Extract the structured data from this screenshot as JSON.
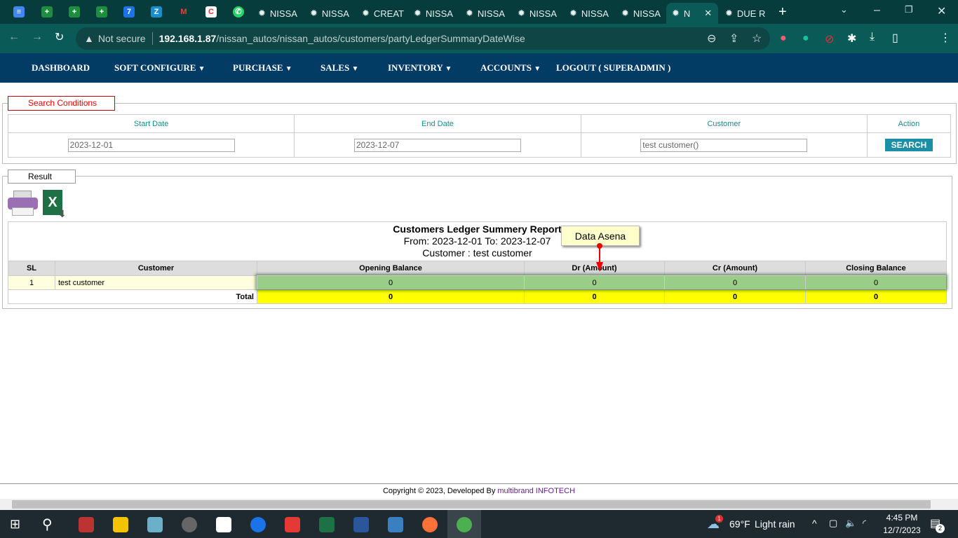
{
  "browser": {
    "tabs": [
      "NISSA",
      "NISSA",
      "CREAT",
      "NISSA",
      "NISSA",
      "NISSA",
      "NISSA",
      "NISSA",
      "N",
      "DUE R"
    ],
    "not_secure": "Not secure",
    "url_host": "192.168.1.87",
    "url_path": "/nissan_autos/nissan_autos/customers/partyLedgerSummaryDateWise"
  },
  "nav": {
    "items": [
      "DASHBOARD",
      "SOFT CONFIGURE",
      "PURCHASE",
      "SALES",
      "INVENTORY",
      "ACCOUNTS",
      "LOGOUT ( SUPERADMIN )"
    ]
  },
  "search": {
    "legend": "Search Conditions",
    "headers": [
      "Start Date",
      "End Date",
      "Customer",
      "Action"
    ],
    "start_date": "2023-12-01",
    "end_date": "2023-12-07",
    "customer": "test customer()",
    "button": "SEARCH"
  },
  "result": {
    "legend": "Result",
    "title": "Customers Ledger Summery Report",
    "range": "From: 2023-12-01 To: 2023-12-07",
    "customer_line": "Customer : test customer",
    "columns": [
      "SL",
      "Customer",
      "Opening Balance",
      "Dr (Amount)",
      "Cr (Amount)",
      "Closing Balance"
    ],
    "rows": [
      {
        "sl": "1",
        "customer": "test customer",
        "opening": "0",
        "dr": "0",
        "cr": "0",
        "closing": "0"
      }
    ],
    "total": {
      "label": "Total",
      "opening": "0",
      "dr": "0",
      "cr": "0",
      "closing": "0"
    }
  },
  "tooltip": "Data Asena",
  "footer": {
    "text": "Copyright © 2023, Developed By ",
    "brand": "multibrand INFOTECH"
  },
  "taskbar": {
    "weather": "69°F",
    "weather_text": "Light rain",
    "time": "4:45 PM",
    "date": "12/7/2023",
    "notifications": "2",
    "weather_badge": "1"
  }
}
